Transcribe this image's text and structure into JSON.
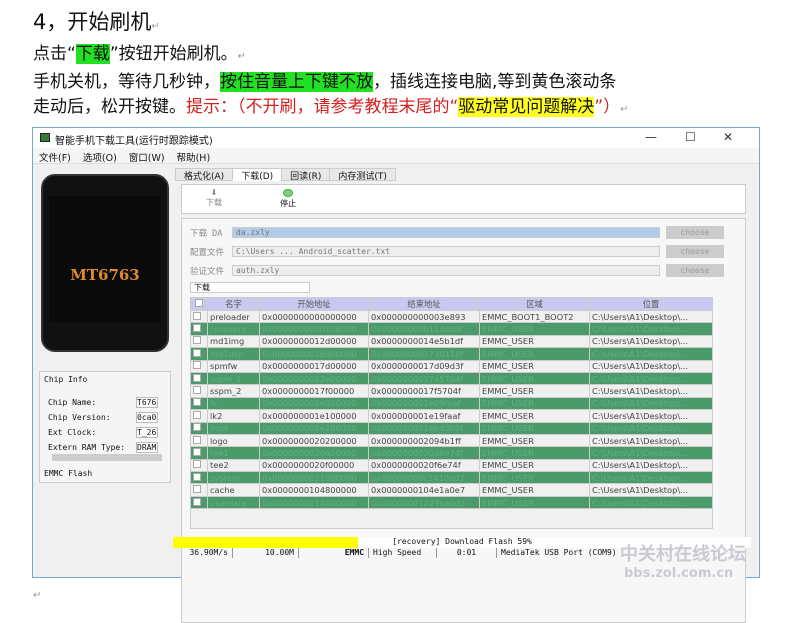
{
  "doc": {
    "heading": "4，开始刷机",
    "line1": {
      "a": "点击“",
      "b": "下载",
      "c": "”按钮开始刷机。"
    },
    "line2": {
      "a": "手机关机，等待几秒钟，",
      "b": "按住音量上下键不放",
      "c": "，插线连接电脑,等到黄色滚动条"
    },
    "line3": {
      "a": "走动后，松开按键。",
      "b": "提示：（不开刷，请参考教程末尾的“",
      "c": "驱动常见问题解决",
      "d": "”）"
    },
    "highlight_green": "#22e022",
    "highlight_yellow": "#ffff22",
    "hint_color": "#d42020"
  },
  "app": {
    "title": "智能手机下载工具(运行时跟踪模式)",
    "menu": [
      "文件(F)",
      "选项(O)",
      "窗口(W)",
      "帮助(H)"
    ],
    "chip_model": "MT6763",
    "chip_info": {
      "title": "Chip Info",
      "rows": [
        {
          "k": "Chip Name:",
          "v": "T676"
        },
        {
          "k": "Chip Version:",
          "v": "0ca0"
        },
        {
          "k": "Ext Clock:",
          "v": "T_26"
        },
        {
          "k": "Extern RAM Type:",
          "v": "DRAM"
        }
      ],
      "flash": "EMMC Flash"
    },
    "tabs": [
      "格式化(A)",
      "下载(D)",
      "回读(R)",
      "内存测试(T)"
    ],
    "toolbar": {
      "download": "下载",
      "stop": "停止"
    },
    "form": {
      "da_label": "下载 DA",
      "da_value": "da.zxly",
      "scatter_label": "配置文件",
      "scatter_value": "C:\\Users ...  Android_scatter.txt",
      "auth_label": "验证文件",
      "auth_value": "auth.zxly",
      "choose": "choose",
      "mode": "下载"
    },
    "table": {
      "headers": [
        "名字",
        "开始地址",
        "结束地址",
        "区域",
        "位置"
      ],
      "rows": [
        [
          "preloader",
          "0x0000000000000000",
          "0x000000000003e893",
          "EMMC_BOOT1_BOOT2",
          "C:\\Users\\A1\\Desktop\\..."
        ],
        [
          "recovery",
          "0x0000000000108000",
          "0x00000000011d4b9f",
          "EMMC_USER",
          "C:\\Users\\A1\\Desktop\\..."
        ],
        [
          "md1img",
          "0x0000000012d00000",
          "0x0000000014e5b1df",
          "EMMC_USER",
          "C:\\Users\\A1\\Desktop\\..."
        ],
        [
          "md1dsp",
          "0x0000000016d00000",
          "0x000000001730118f",
          "EMMC_USER",
          "C:\\Users\\A1\\Desktop\\..."
        ],
        [
          "spmfw",
          "0x0000000017d00000",
          "0x0000000017d09d3f",
          "EMMC_USER",
          "C:\\Users\\A1\\Desktop\\..."
        ],
        [
          "sspm_1",
          "0x0000000017e00000",
          "0x0000000017e5704f",
          "EMMC_USER",
          "C:\\Users\\A1\\Desktop\\..."
        ],
        [
          "sspm_2",
          "0x0000000017f00000",
          "0x0000000017f5704f",
          "EMMC_USER",
          "C:\\Users\\A1\\Desktop\\..."
        ],
        [
          "lk",
          "0x000000001e000000",
          "0x000000001e09faaf",
          "EMMC_USER",
          "C:\\Users\\A1\\Desktop\\..."
        ],
        [
          "lk2",
          "0x000000001e100000",
          "0x000000001e19faaf",
          "EMMC_USER",
          "C:\\Users\\A1\\Desktop\\..."
        ],
        [
          "boot",
          "0x000000001e200000",
          "0x000000001ebd3b9f",
          "EMMC_USER",
          "C:\\Users\\A1\\Desktop\\..."
        ],
        [
          "logo",
          "0x0000000020200000",
          "0x000000002094b1ff",
          "EMMC_USER",
          "C:\\Users\\A1\\Desktop\\..."
        ],
        [
          "tee1",
          "0x0000000020a00000",
          "0x0000000020a6e74f",
          "EMMC_USER",
          "C:\\Users\\A1\\Desktop\\..."
        ],
        [
          "tee2",
          "0x0000000020f00000",
          "0x0000000020f6e74f",
          "EMMC_USER",
          "C:\\Users\\A1\\Desktop\\..."
        ],
        [
          "system",
          "0x0000000021800000",
          "0x00000000c2410ad7",
          "EMMC_USER",
          "C:\\Users\\A1\\Desktop\\..."
        ],
        [
          "cache",
          "0x0000000104800000",
          "0x0000000104e1a0e7",
          "EMMC_USER",
          "C:\\Users\\A1\\Desktop\\..."
        ],
        [
          "userdata",
          "0x0000000114800000",
          "0x00000001249bebd3",
          "EMMC_USER",
          "C:\\Users\\A1\\Desktop\\..."
        ]
      ]
    },
    "progress": {
      "text": "[recovery] Download Flash 59%",
      "fill_percent": 32,
      "color": "#ffff00"
    },
    "status": [
      "36.90M/s",
      "10.00M",
      "EMMC",
      "High Speed",
      "0:01",
      "MediaTek USB Port (COM9)"
    ]
  },
  "watermark": {
    "line1": "中关村在线论坛",
    "line2": "bbs.zol.com.cn"
  }
}
